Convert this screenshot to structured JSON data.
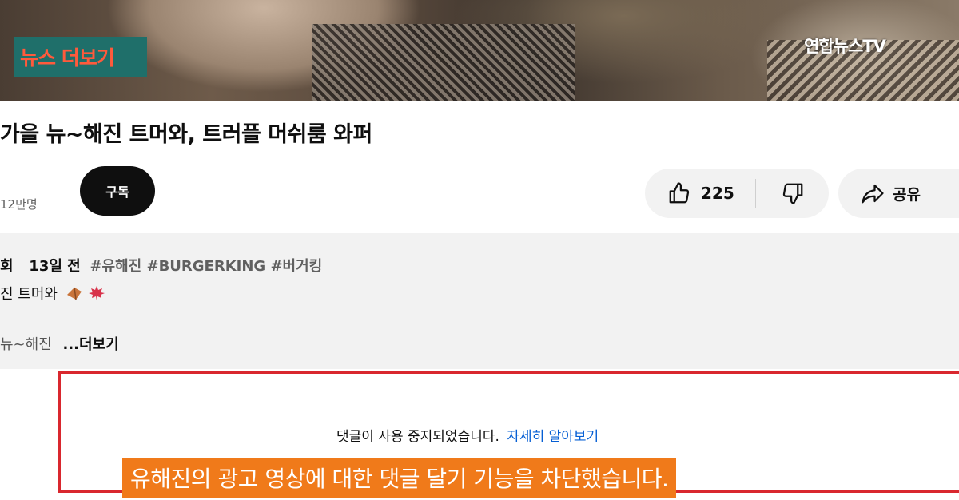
{
  "video_overlay": {
    "news_more_label": "뉴스 더보기",
    "channel_logo": "연합뉴스TV"
  },
  "video_title": "가을 뉴~해진 트머와, 트러플 머쉬룸 와퍼",
  "channel": {
    "subscriber_count": "12만명",
    "subscribe_label": "구독"
  },
  "actions": {
    "like_count": "225",
    "share_label": "공유",
    "like_icon": "thumbs-up-icon",
    "dislike_icon": "thumbs-down-icon",
    "share_icon": "share-arrow-icon"
  },
  "description": {
    "view_prefix": "회",
    "date": "13일 전",
    "tags": "#유해진 #BURGERKING #버거킹",
    "line1": "진 트머와",
    "line3_prefix": "뉴~해진",
    "more_label": "...더보기"
  },
  "comments": {
    "disabled_message": "댓글이 사용 중지되었습니다.",
    "learn_more": "자세히 알아보기",
    "highlight_color": "#d9272e"
  },
  "caption": {
    "text": "유해진의 광고 영상에 대한 댓글 달기 기능을 차단했습니다."
  }
}
